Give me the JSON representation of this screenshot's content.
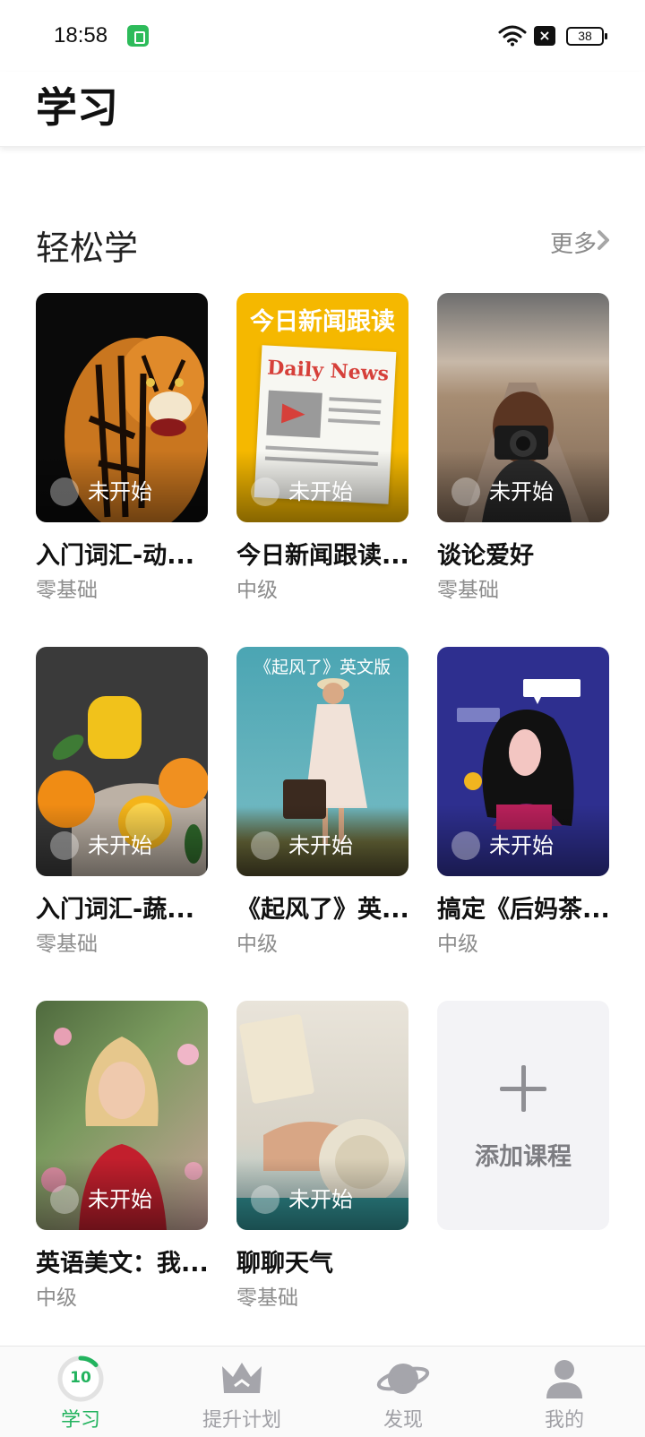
{
  "status_bar": {
    "time": "18:58",
    "battery": "38"
  },
  "header": {
    "title": "学习"
  },
  "section": {
    "title": "轻松学",
    "more": "更多"
  },
  "courses": [
    {
      "title": "入门词汇-动...",
      "level": "零基础",
      "status": "未开始",
      "cover_text": ""
    },
    {
      "title": "今日新闻跟读...",
      "level": "中级",
      "status": "未开始",
      "cover_text": "今日新闻跟读",
      "cover_sub": "Daily News"
    },
    {
      "title": "谈论爱好",
      "level": "零基础",
      "status": "未开始",
      "cover_text": ""
    },
    {
      "title": "入门词汇-蔬...",
      "level": "零基础",
      "status": "未开始",
      "cover_text": ""
    },
    {
      "title": "《起风了》英...",
      "level": "中级",
      "status": "未开始",
      "cover_text": "《起风了》英文版"
    },
    {
      "title": "搞定《后妈茶...",
      "level": "中级",
      "status": "未开始",
      "cover_text": ""
    },
    {
      "title": "英语美文：我...",
      "level": "中级",
      "status": "未开始",
      "cover_text": ""
    },
    {
      "title": "聊聊天气",
      "level": "零基础",
      "status": "未开始",
      "cover_text": ""
    }
  ],
  "add_course": {
    "label": "添加课程"
  },
  "bottom_nav": {
    "items": [
      {
        "label": "学习",
        "icon": "progress-ring-icon",
        "active": true,
        "badge": "10"
      },
      {
        "label": "提升计划",
        "icon": "crown-icon",
        "active": false
      },
      {
        "label": "发现",
        "icon": "planet-icon",
        "active": false
      },
      {
        "label": "我的",
        "icon": "person-icon",
        "active": false
      }
    ]
  },
  "colors": {
    "accent": "#22b35e",
    "muted": "#a0a0a5",
    "news_yellow": "#f5b800",
    "purple_bg": "#2e2f8f"
  }
}
